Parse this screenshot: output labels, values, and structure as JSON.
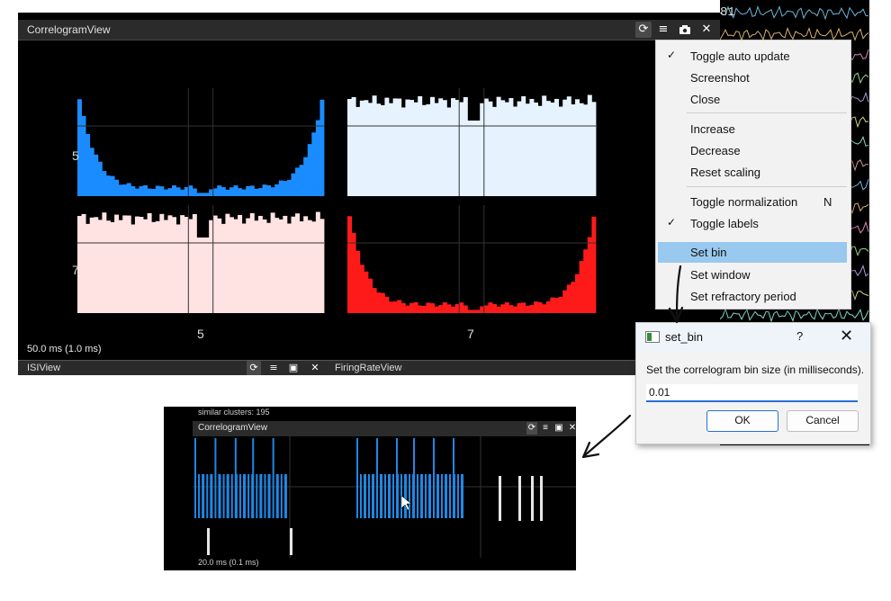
{
  "correlogram": {
    "title": "CorrelogramView",
    "status": "50.0 ms (1.0 ms)",
    "row_labels": [
      "5",
      "7"
    ],
    "col_labels": [
      "5",
      "7"
    ],
    "colors": {
      "cluster5": "#1a8cff",
      "cluster7": "#ff1a1a",
      "cross_5_7": "#e6f3ff",
      "cross_7_5": "#ffe3e3",
      "background": "#000000"
    }
  },
  "lower_views": {
    "isi_title": "ISIView",
    "firing_rate_title": "FiringRateView"
  },
  "trace_strip": {
    "label": "81"
  },
  "toolbar_icons": [
    "refresh-icon",
    "menu-icon",
    "camera-icon",
    "close-icon"
  ],
  "context_menu": {
    "groups": [
      [
        {
          "label": "Toggle auto update",
          "checked": true
        },
        {
          "label": "Screenshot",
          "checked": false
        },
        {
          "label": "Close",
          "checked": false
        }
      ],
      [
        {
          "label": "Increase",
          "checked": false
        },
        {
          "label": "Decrease",
          "checked": false
        },
        {
          "label": "Reset scaling",
          "checked": false
        }
      ],
      [
        {
          "label": "Toggle normalization",
          "shortcut": "N",
          "checked": false
        },
        {
          "label": "Toggle labels",
          "checked": true
        },
        {
          "label": "Set bin",
          "highlighted": true
        },
        {
          "label": "Set window",
          "checked": false
        },
        {
          "label": "Set refractory period",
          "checked": false
        }
      ]
    ]
  },
  "dialog": {
    "title": "set_bin",
    "help": "?",
    "close": "✕",
    "message": "Set the correlogram bin size (in milliseconds).",
    "input_value": "0.01",
    "ok_label": "OK",
    "cancel_label": "Cancel"
  },
  "inset": {
    "similar_clusters": "similar clusters: 195",
    "title": "CorrelogramView",
    "status": "20.0 ms (0.1 ms)"
  }
}
